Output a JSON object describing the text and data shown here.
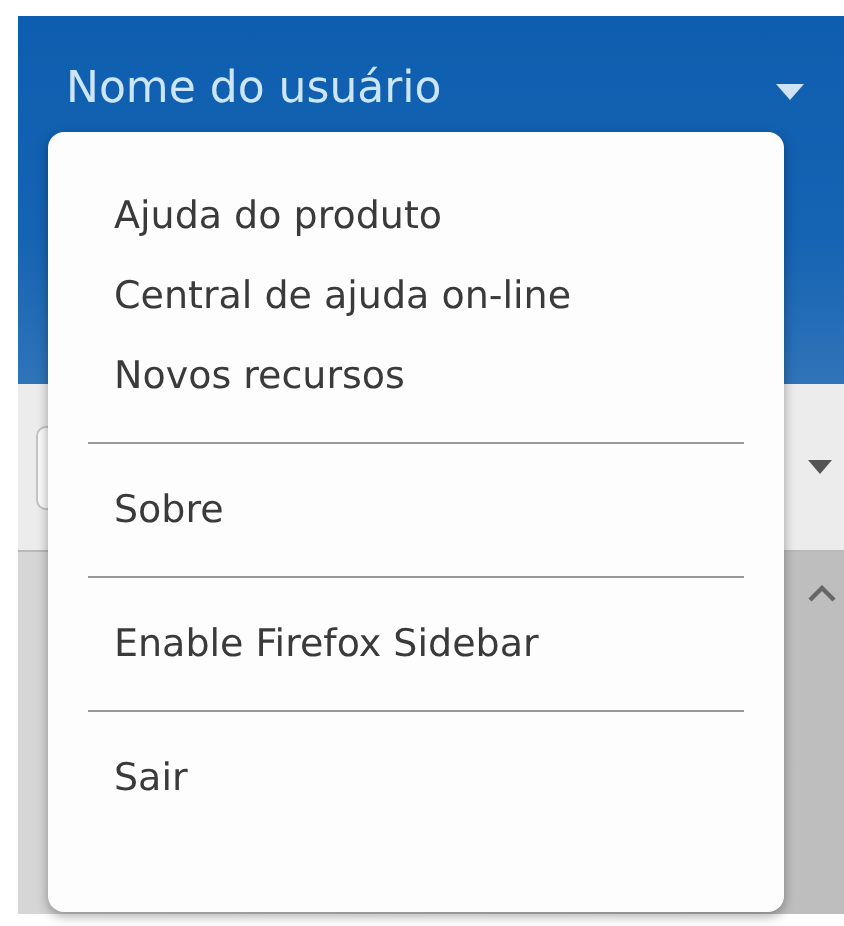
{
  "header": {
    "user_name": "Nome do usuário"
  },
  "menu": {
    "groups": [
      {
        "items": [
          {
            "label": "Ajuda do produto"
          },
          {
            "label": "Central de ajuda on-line"
          },
          {
            "label": "Novos recursos"
          }
        ]
      },
      {
        "items": [
          {
            "label": "Sobre"
          }
        ]
      },
      {
        "items": [
          {
            "label": "Enable Firefox Sidebar"
          }
        ]
      },
      {
        "items": [
          {
            "label": "Sair"
          }
        ]
      }
    ]
  }
}
